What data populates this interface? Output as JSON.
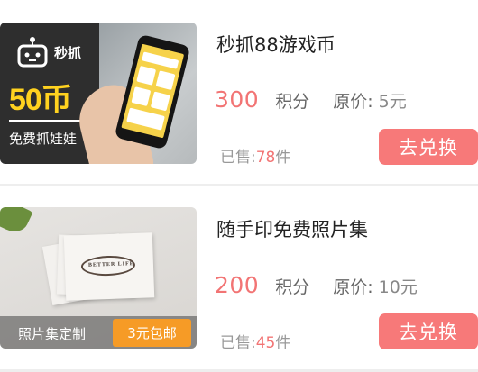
{
  "items": [
    {
      "title": "秒抓88游戏币",
      "points": "300",
      "points_unit": "积分",
      "original_label": "原价:",
      "original_value": "5元",
      "sold_label": "已售:",
      "sold_count": "78",
      "sold_unit": "件",
      "button_label": "去兑换",
      "thumb": {
        "logo_text": "秒抓",
        "big_text": "50币",
        "sub_text": "免费抓娃娃"
      }
    },
    {
      "title": "随手印免费照片集",
      "points": "200",
      "points_unit": "积分",
      "original_label": "原价:",
      "original_value": "10元",
      "sold_label": "已售:",
      "sold_count": "45",
      "sold_unit": "件",
      "button_label": "去兑换",
      "thumb": {
        "card_text": "BETTER LIFE",
        "bar_text": "照片集定制",
        "badge_text": "3元包邮"
      }
    }
  ],
  "colors": {
    "accent": "#f77979",
    "price": "#f27474",
    "badge": "#f69b26",
    "coin_text": "#ffd21f"
  }
}
